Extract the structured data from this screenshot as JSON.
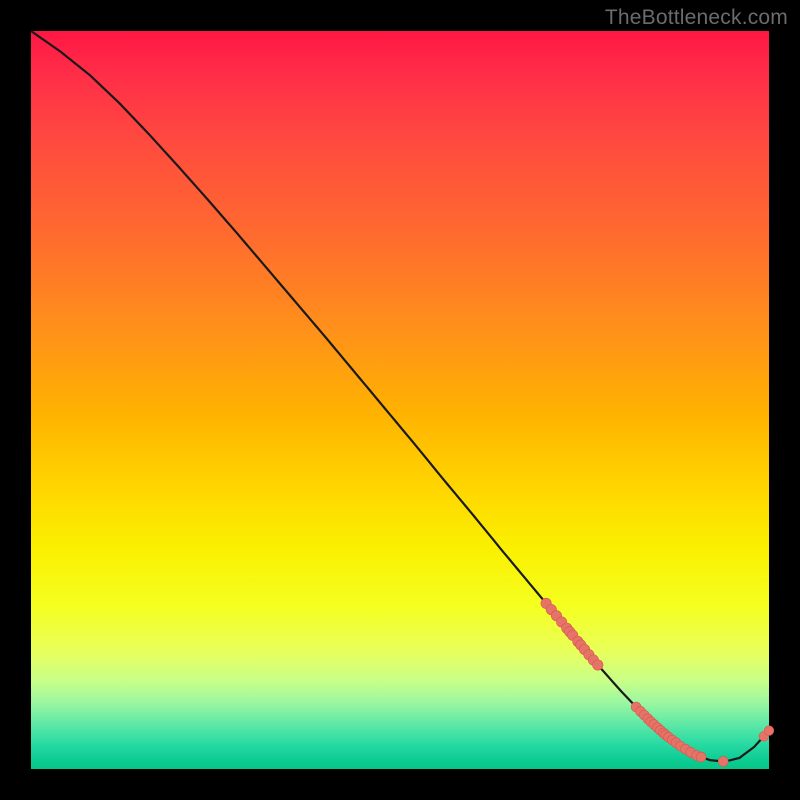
{
  "watermark": "TheBottleneck.com",
  "colors": {
    "curve_stroke": "#1a1a1a",
    "marker_fill": "#e57368",
    "marker_stroke": "#d9564e"
  },
  "chart_data": {
    "type": "line",
    "title": "",
    "xlabel": "",
    "ylabel": "",
    "xlim": [
      0,
      100
    ],
    "ylim": [
      0,
      100
    ],
    "grid": false,
    "legend": false,
    "series": [
      {
        "name": "bottleneck-curve",
        "x": [
          0,
          4,
          8,
          12,
          16,
          20,
          24,
          28,
          32,
          36,
          40,
          44,
          48,
          52,
          56,
          60,
          64,
          68,
          72,
          76,
          80,
          82,
          84,
          86,
          88,
          90,
          92,
          94,
          96,
          98,
          100
        ],
        "y": [
          100,
          97.2,
          94.0,
          90.2,
          86.0,
          81.6,
          77.1,
          72.5,
          67.8,
          63.1,
          58.4,
          53.6,
          48.8,
          44.0,
          39.1,
          34.3,
          29.4,
          24.6,
          19.8,
          15.0,
          10.5,
          8.4,
          6.4,
          4.6,
          3.1,
          1.9,
          1.2,
          1.0,
          1.5,
          3.0,
          5.2
        ]
      }
    ],
    "cluster_a_markers_x": [
      69.8,
      70.5,
      71.2,
      71.9,
      72.6,
      73.0,
      73.4,
      74.1,
      74.5,
      75.0,
      75.6,
      76.2,
      76.8
    ],
    "cluster_b_markers_x": [
      82.0,
      82.6,
      83.1,
      83.6,
      84.0,
      84.4,
      84.9,
      85.3,
      85.7,
      86.0,
      86.4,
      86.9,
      87.4,
      88.0,
      88.7,
      89.4,
      90.2,
      90.8,
      93.8
    ],
    "tail_markers_x": [
      99.3,
      100.0
    ]
  }
}
